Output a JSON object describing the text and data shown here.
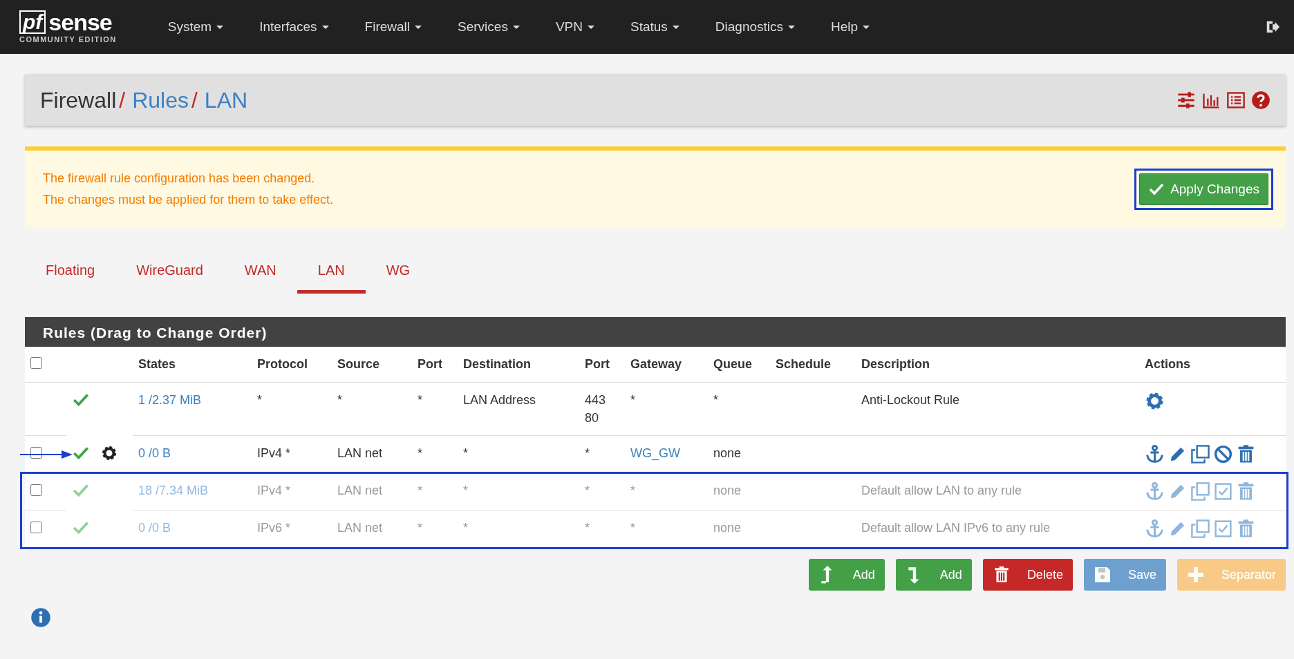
{
  "navbar": {
    "logo_mark": "pf",
    "logo_text": "sense",
    "logo_subtitle": "COMMUNITY EDITION",
    "menu": [
      "System",
      "Interfaces",
      "Firewall",
      "Services",
      "VPN",
      "Status",
      "Diagnostics",
      "Help"
    ]
  },
  "breadcrumb": [
    {
      "text": "Firewall",
      "kind": "plain"
    },
    {
      "text": "/",
      "kind": "separator"
    },
    {
      "text": "Rules",
      "kind": "link"
    },
    {
      "text": "/",
      "kind": "separator"
    },
    {
      "text": "LAN",
      "kind": "link"
    }
  ],
  "alert": {
    "lines": [
      "The firewall rule configuration has been changed.",
      "The changes must be applied for them to take effect."
    ],
    "apply_button": {
      "label": "Apply Changes",
      "highlighted": true
    }
  },
  "tabs": [
    {
      "label": "Floating",
      "selected": false
    },
    {
      "label": "WireGuard",
      "selected": false
    },
    {
      "label": "WAN",
      "selected": false
    },
    {
      "label": "LAN",
      "selected": true
    },
    {
      "label": "WG",
      "selected": false
    }
  ],
  "rules_panel": {
    "title": "Rules (Drag to Change Order)",
    "select_all_checked": false,
    "columns": [
      "States",
      "Protocol",
      "Source",
      "Port",
      "Destination",
      "Port",
      "Gateway",
      "Queue",
      "Schedule",
      "Description",
      "Actions"
    ],
    "rows": [
      {
        "kind": "fixed",
        "disabled": false,
        "advanced": false,
        "pointer": false,
        "highlighted": false,
        "states": "1 /2.37 MiB",
        "protocol": "*",
        "source": "*",
        "source_port": "*",
        "destination": "LAN Address",
        "destination_port": [
          "443",
          "80"
        ],
        "gateway": "*",
        "gateway_link": false,
        "queue": "*",
        "description": "Anti-Lockout Rule"
      },
      {
        "kind": "rule",
        "checked": false,
        "disabled": false,
        "advanced": true,
        "pointer": true,
        "highlighted": false,
        "states": "0 /0 B",
        "protocol": "IPv4 *",
        "source": "LAN net",
        "source_port": "*",
        "destination": "*",
        "destination_port": [
          "*"
        ],
        "gateway": "WG_GW",
        "gateway_link": true,
        "queue": "none"
      },
      {
        "kind": "rule",
        "checked": false,
        "disabled": true,
        "advanced": false,
        "pointer": false,
        "highlighted": true,
        "states": "18 /7.34 MiB",
        "protocol": "IPv4 *",
        "source": "LAN net",
        "source_port": "*",
        "destination": "*",
        "destination_port": [
          "*"
        ],
        "gateway": "*",
        "gateway_link": false,
        "queue": "none",
        "description": "Default allow LAN to any rule"
      },
      {
        "kind": "rule",
        "checked": false,
        "disabled": true,
        "advanced": false,
        "pointer": false,
        "highlighted": true,
        "states": "0 /0 B",
        "protocol": "IPv6 *",
        "source": "LAN net",
        "source_port": "*",
        "destination": "*",
        "destination_port": [
          "*"
        ],
        "gateway": "*",
        "gateway_link": false,
        "queue": "none",
        "description": "Default allow LAN IPv6 to any rule"
      }
    ]
  },
  "buttons": [
    {
      "label": "Add",
      "kind": "add_top",
      "disabled": false
    },
    {
      "label": "Add",
      "kind": "add_bottom",
      "disabled": false
    },
    {
      "label": "Delete",
      "kind": "delete",
      "disabled": false
    },
    {
      "label": "Save",
      "kind": "save",
      "disabled": true
    },
    {
      "label": "Separator",
      "kind": "separator",
      "disabled": true
    }
  ]
}
